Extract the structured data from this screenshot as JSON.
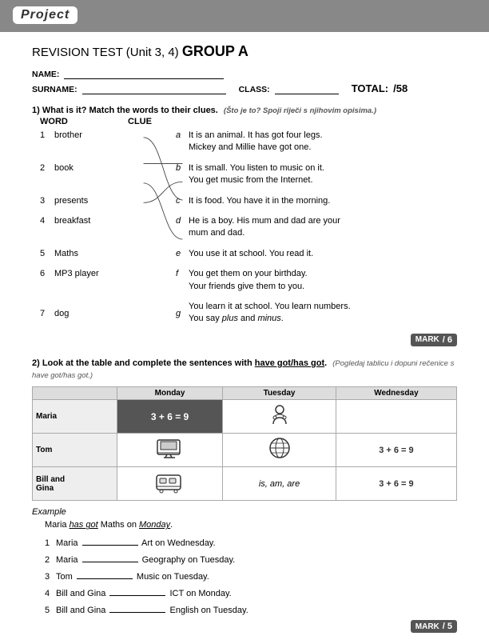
{
  "header": {
    "badge": "Project"
  },
  "title": {
    "revision": "REVISION TEST (Unit 3, 4) ",
    "group": "GROUP A"
  },
  "fields": {
    "name_label": "NAME:",
    "surname_label": "SURNAME:",
    "class_label": "CLASS:",
    "total_label": "TOTAL:",
    "total_value": "/58"
  },
  "section1": {
    "header": "1) What is it? Match the words to their clues.",
    "subtext": "(Što je to? Spoji riječi s njihovim opisima.)",
    "col_word": "WORD",
    "col_clue": "CLUE",
    "items": [
      {
        "num": "1",
        "word": "brother",
        "clue_letter": "a",
        "clue_text": "It is an animal. It has got four legs. Mickey and Millie have got one."
      },
      {
        "num": "2",
        "word": "book",
        "clue_letter": "b",
        "clue_text": "It is small. You listen to music on it. You get music from the Internet."
      },
      {
        "num": "3",
        "word": "presents",
        "clue_letter": "c",
        "clue_text": "It is food. You have it in the morning."
      },
      {
        "num": "4",
        "word": "breakfast",
        "clue_letter": "d",
        "clue_text": "He is a boy. His mum and dad are your mum and dad."
      },
      {
        "num": "5",
        "word": "Maths",
        "clue_letter": "e",
        "clue_text": "You use it at school. You read it."
      },
      {
        "num": "6",
        "word": "MP3 player",
        "clue_letter": "f",
        "clue_text": "You get them on your birthday. Your friends give them to you."
      },
      {
        "num": "7",
        "word": "dog",
        "clue_letter": "g",
        "clue_text": "You learn it at school. You learn numbers. You say plus and minus."
      }
    ],
    "mark_label": "MARK",
    "mark_value": "/ 6"
  },
  "section2": {
    "header": "2) Look at the table and complete the sentences with",
    "header_underline": "have got/has got",
    "header_suffix": ".",
    "subtext": "(Pogledaj tablicu i dopuni rečenice s have got/has got.)",
    "table": {
      "headers": [
        "",
        "Monday",
        "Tuesday",
        "Wednesday"
      ],
      "rows": [
        {
          "name": "Maria",
          "monday_math": "3 + 6 = 9",
          "tuesday_icon": "🎵",
          "wednesday": ""
        },
        {
          "name": "Tom",
          "monday_icon": "💻",
          "tuesday_icon": "🌍",
          "wednesday_math": "3 + 6 = 9"
        },
        {
          "name": "Bill and Gina",
          "monday_icon": "🚌",
          "tuesday_words": "is, am, are",
          "wednesday_math": "3 + 6 = 9"
        }
      ]
    },
    "example_label": "Example",
    "example_sentence": "Maria has got Maths on Monday.",
    "sentences": [
      {
        "num": "1",
        "text_before": "Maria",
        "blank": "",
        "text_after": "Art on Wednesday."
      },
      {
        "num": "2",
        "text_before": "Maria",
        "blank": "",
        "text_after": "Geography on Tuesday."
      },
      {
        "num": "3",
        "text_before": "Tom",
        "blank": "",
        "text_after": "Music on Tuesday."
      },
      {
        "num": "4",
        "text_before": "Bill and Gina",
        "blank": "",
        "text_after": "ICT on Monday."
      },
      {
        "num": "5",
        "text_before": "Bill and Gina",
        "blank": "",
        "text_after": "English on Tuesday."
      }
    ],
    "mark_label": "MARK",
    "mark_value": "/ 5"
  }
}
